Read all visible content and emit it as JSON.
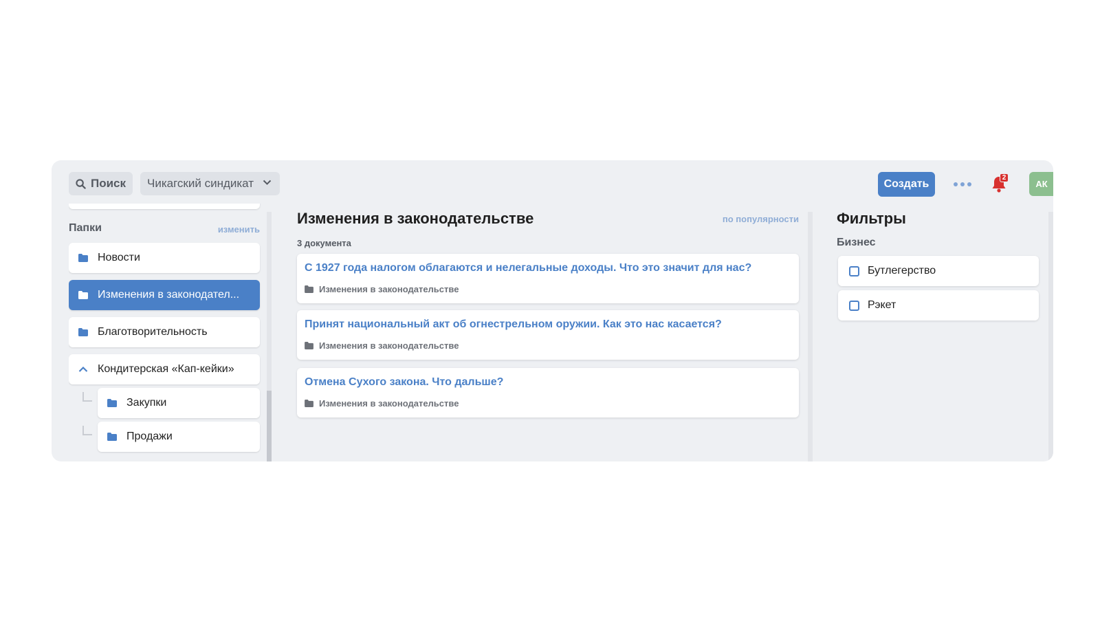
{
  "header": {
    "search_label": "Поиск",
    "org_selector": "Чикагский синдикат",
    "create_label": "Создать",
    "notifications_count": "2",
    "avatar_initials": "АК"
  },
  "sidebar": {
    "title": "Папки",
    "edit_label": "изменить",
    "folders": [
      {
        "label": "Новости"
      },
      {
        "label": "Изменения в законодател..."
      },
      {
        "label": "Благотворительность"
      },
      {
        "label": "Кондитерская «Кап-кейки»"
      }
    ],
    "subfolders": [
      {
        "label": "Закупки"
      },
      {
        "label": "Продажи"
      }
    ]
  },
  "main": {
    "title": "Изменения в законодательстве",
    "sort_label": "по популярности",
    "count_label": "3 документа",
    "documents": [
      {
        "title": "С 1927 года налогом облагаются и нелегальные доходы. Что это значит для нас?",
        "folder": "Изменения в законодательстве"
      },
      {
        "title": "Принят национальный акт об огнестрельном оружии. Как это нас касается?",
        "folder": "Изменения в законодательстве"
      },
      {
        "title": "Отмена Сухого закона. Что дальше?",
        "folder": "Изменения в законодательстве"
      }
    ]
  },
  "filters": {
    "title": "Фильтры",
    "group_label": "Бизнес",
    "options": [
      {
        "label": "Бутлегерство"
      },
      {
        "label": "Рэкет"
      }
    ]
  },
  "colors": {
    "accent": "#4a80c7",
    "panel_bg": "#eef0f3",
    "badge": "#d8312f",
    "avatar": "#8cbf8f"
  }
}
